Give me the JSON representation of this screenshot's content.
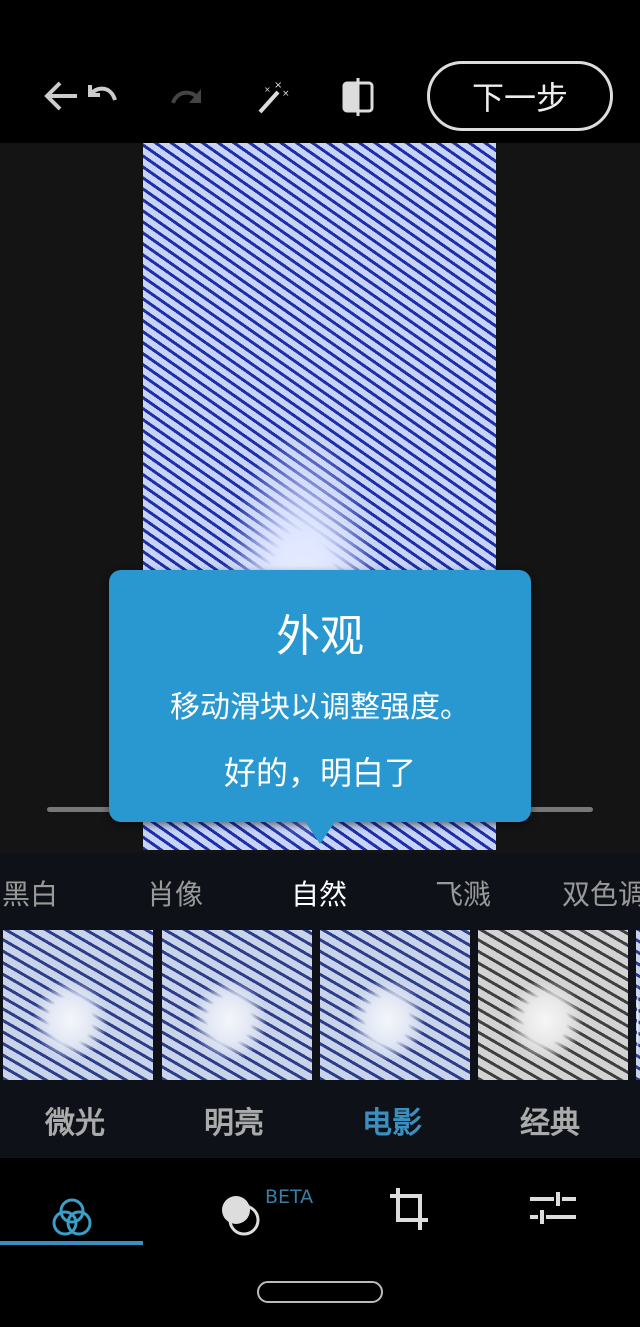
{
  "toolbar": {
    "back": "back-icon",
    "undo": "undo-icon",
    "redo": "redo-icon",
    "auto_fix": "magic-wand-icon",
    "compare": "compare-icon",
    "next_label": "下一步"
  },
  "tooltip": {
    "title": "外观",
    "message": "移动滑块以调整强度。",
    "ok_label": "好的，明白了"
  },
  "categories": [
    {
      "label": "黑白"
    },
    {
      "label": "肖像"
    },
    {
      "label": "自然",
      "selected": true
    },
    {
      "label": "飞溅"
    },
    {
      "label": "双色调"
    }
  ],
  "looks": [
    {
      "label": "微光"
    },
    {
      "label": "明亮"
    },
    {
      "label": "电影",
      "selected": true
    },
    {
      "label": "经典"
    }
  ],
  "bottom_tabs": {
    "looks": "looks-icon",
    "heal": "heal-icon",
    "beta": "BETA",
    "crop": "crop-icon",
    "adjust": "adjust-icon"
  },
  "colors": {
    "accent": "#2a98d0",
    "selected_look": "#3a8fbf"
  }
}
